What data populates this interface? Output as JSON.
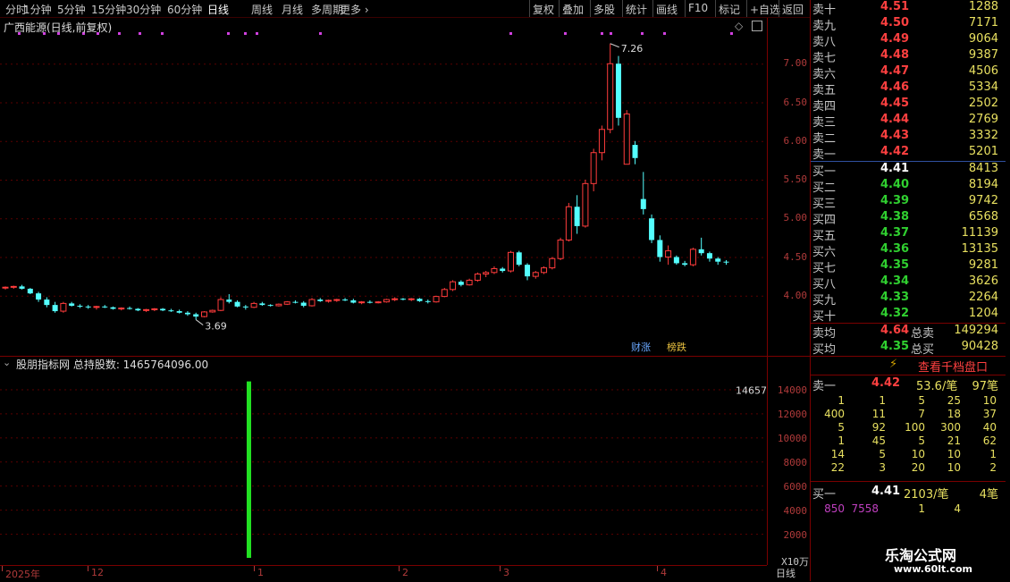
{
  "toolbar": {
    "periods": [
      "分时",
      "1分钟",
      "5分钟",
      "15分钟",
      "30分钟",
      "60分钟",
      "日线",
      "周线",
      "月线",
      "多周期",
      "更多"
    ],
    "active_period": "日线",
    "buttons": [
      "复权",
      "叠加",
      "多股",
      "统计",
      "画线",
      "F10",
      "标记",
      "+自选",
      "返回"
    ]
  },
  "stock": {
    "title": "广西能源(日线,前复权)"
  },
  "price_axis": {
    "labels": [
      "7.00",
      "6.50",
      "6.00",
      "5.50",
      "5.00",
      "4.50",
      "4.00"
    ],
    "values": [
      7.0,
      6.5,
      6.0,
      5.5,
      5.0,
      4.5,
      4.0
    ],
    "range": [
      3.5,
      7.5
    ]
  },
  "annotations": {
    "high": "7.26",
    "low": "3.69",
    "tag_caizhang": "财涨",
    "tag_bangdie": "榜跌"
  },
  "indicator": {
    "header": "股朋指标网 总持股数: 1465764096.00",
    "peak_label": "14657",
    "axis_labels": [
      "14000",
      "12000",
      "10000",
      "8000",
      "6000",
      "4000",
      "2000"
    ],
    "axis_values": [
      14000,
      12000,
      10000,
      8000,
      6000,
      4000,
      2000
    ],
    "unit": "X10万",
    "bar_value": 14657
  },
  "date_axis": {
    "labels": [
      "2025年",
      "12",
      "1",
      "2",
      "3",
      "4"
    ],
    "period_label": "日线"
  },
  "order_book": {
    "asks": [
      {
        "label": "卖十",
        "price": "4.51",
        "vol": "1288"
      },
      {
        "label": "卖九",
        "price": "4.50",
        "vol": "7171"
      },
      {
        "label": "卖八",
        "price": "4.49",
        "vol": "9064"
      },
      {
        "label": "卖七",
        "price": "4.48",
        "vol": "9387"
      },
      {
        "label": "卖六",
        "price": "4.47",
        "vol": "4506"
      },
      {
        "label": "卖五",
        "price": "4.46",
        "vol": "5334"
      },
      {
        "label": "卖四",
        "price": "4.45",
        "vol": "2502"
      },
      {
        "label": "卖三",
        "price": "4.44",
        "vol": "2769"
      },
      {
        "label": "卖二",
        "price": "4.43",
        "vol": "3332"
      },
      {
        "label": "卖一",
        "price": "4.42",
        "vol": "5201"
      }
    ],
    "bids": [
      {
        "label": "买一",
        "price": "4.41",
        "vol": "8413"
      },
      {
        "label": "买二",
        "price": "4.40",
        "vol": "8194"
      },
      {
        "label": "买三",
        "price": "4.39",
        "vol": "9742"
      },
      {
        "label": "买四",
        "price": "4.38",
        "vol": "6568"
      },
      {
        "label": "买五",
        "price": "4.37",
        "vol": "11139"
      },
      {
        "label": "买六",
        "price": "4.36",
        "vol": "13135"
      },
      {
        "label": "买七",
        "price": "4.35",
        "vol": "9281"
      },
      {
        "label": "买八",
        "price": "4.34",
        "vol": "3626"
      },
      {
        "label": "买九",
        "price": "4.33",
        "vol": "2264"
      },
      {
        "label": "买十",
        "price": "4.32",
        "vol": "1204"
      }
    ],
    "avg_sell": {
      "label": "卖均",
      "price": "4.64",
      "total_label": "总卖",
      "total": "149294"
    },
    "avg_buy": {
      "label": "买均",
      "price": "4.35",
      "total_label": "总买",
      "total": "90428"
    }
  },
  "thousand_btn": "查看千档盘口",
  "sell1_detail": {
    "label": "卖一",
    "price": "4.42",
    "per": "53.6/笔",
    "count": "97笔",
    "grid": [
      [
        "1",
        "1",
        "5",
        "25",
        "10"
      ],
      [
        "400",
        "11",
        "7",
        "18",
        "37"
      ],
      [
        "5",
        "92",
        "100",
        "300",
        "40"
      ],
      [
        "1",
        "45",
        "5",
        "21",
        "62"
      ],
      [
        "14",
        "5",
        "10",
        "10",
        "1"
      ],
      [
        "22",
        "3",
        "20",
        "10",
        "2"
      ]
    ]
  },
  "buy1_detail": {
    "label": "买一",
    "price": "4.41",
    "per": "2103/笔",
    "count": "4笔",
    "grid": [
      "850",
      "7558",
      "1",
      "4"
    ]
  },
  "watermark": {
    "line1": "乐淘公式网",
    "line2": "www.60lt.com"
  },
  "colors": {
    "up": "#ff3c3c",
    "down": "#54ffff",
    "bar": "#22e022",
    "grid": "#5a0000",
    "axis": "#b03a3a"
  },
  "chart_data": {
    "type": "candlestick",
    "candles": [
      [
        4.1,
        4.12,
        4.08,
        4.11
      ],
      [
        4.11,
        4.13,
        4.09,
        4.12
      ],
      [
        4.12,
        4.14,
        4.08,
        4.09
      ],
      [
        4.09,
        4.1,
        4.02,
        4.03
      ],
      [
        4.03,
        4.05,
        3.92,
        3.95
      ],
      [
        3.95,
        3.98,
        3.85,
        3.88
      ],
      [
        3.88,
        3.92,
        3.78,
        3.8
      ],
      [
        3.8,
        3.92,
        3.78,
        3.9
      ],
      [
        3.9,
        3.92,
        3.86,
        3.87
      ],
      [
        3.87,
        3.89,
        3.84,
        3.86
      ],
      [
        3.86,
        3.88,
        3.83,
        3.85
      ],
      [
        3.85,
        3.87,
        3.82,
        3.86
      ],
      [
        3.86,
        3.88,
        3.84,
        3.85
      ],
      [
        3.85,
        3.86,
        3.82,
        3.83
      ],
      [
        3.83,
        3.85,
        3.81,
        3.84
      ],
      [
        3.84,
        3.86,
        3.82,
        3.83
      ],
      [
        3.83,
        3.84,
        3.8,
        3.81
      ],
      [
        3.81,
        3.83,
        3.79,
        3.82
      ],
      [
        3.82,
        3.84,
        3.8,
        3.83
      ],
      [
        3.83,
        3.84,
        3.8,
        3.81
      ],
      [
        3.81,
        3.83,
        3.79,
        3.8
      ],
      [
        3.8,
        3.82,
        3.77,
        3.78
      ],
      [
        3.78,
        3.8,
        3.74,
        3.76
      ],
      [
        3.76,
        3.78,
        3.69,
        3.73
      ],
      [
        3.73,
        3.8,
        3.72,
        3.79
      ],
      [
        3.79,
        3.82,
        3.78,
        3.81
      ],
      [
        3.81,
        3.98,
        3.8,
        3.95
      ],
      [
        3.95,
        4.02,
        3.9,
        3.92
      ],
      [
        3.92,
        3.94,
        3.85,
        3.86
      ],
      [
        3.86,
        3.88,
        3.82,
        3.85
      ],
      [
        3.85,
        3.92,
        3.84,
        3.9
      ],
      [
        3.9,
        3.92,
        3.87,
        3.88
      ],
      [
        3.88,
        3.89,
        3.86,
        3.87
      ],
      [
        3.87,
        3.9,
        3.86,
        3.89
      ],
      [
        3.89,
        3.93,
        3.88,
        3.92
      ],
      [
        3.92,
        3.94,
        3.9,
        3.91
      ],
      [
        3.91,
        3.93,
        3.85,
        3.87
      ],
      [
        3.87,
        3.97,
        3.86,
        3.95
      ],
      [
        3.95,
        3.97,
        3.92,
        3.93
      ],
      [
        3.93,
        3.95,
        3.91,
        3.94
      ],
      [
        3.94,
        3.96,
        3.92,
        3.95
      ],
      [
        3.95,
        3.97,
        3.93,
        3.94
      ],
      [
        3.94,
        3.96,
        3.9,
        3.91
      ],
      [
        3.91,
        3.93,
        3.89,
        3.92
      ],
      [
        3.92,
        3.94,
        3.9,
        3.91
      ],
      [
        3.91,
        3.93,
        3.9,
        3.92
      ],
      [
        3.92,
        3.96,
        3.91,
        3.95
      ],
      [
        3.95,
        3.98,
        3.93,
        3.96
      ],
      [
        3.96,
        3.97,
        3.94,
        3.95
      ],
      [
        3.95,
        3.97,
        3.93,
        3.96
      ],
      [
        3.96,
        3.97,
        3.92,
        3.93
      ],
      [
        3.93,
        3.95,
        3.9,
        3.92
      ],
      [
        3.92,
        4.0,
        3.91,
        3.99
      ],
      [
        3.99,
        4.1,
        3.98,
        4.08
      ],
      [
        4.08,
        4.2,
        4.06,
        4.18
      ],
      [
        4.18,
        4.2,
        4.12,
        4.14
      ],
      [
        4.14,
        4.22,
        4.13,
        4.2
      ],
      [
        4.2,
        4.3,
        4.18,
        4.28
      ],
      [
        4.28,
        4.32,
        4.24,
        4.3
      ],
      [
        4.3,
        4.38,
        4.28,
        4.35
      ],
      [
        4.35,
        4.37,
        4.3,
        4.32
      ],
      [
        4.32,
        4.58,
        4.3,
        4.56
      ],
      [
        4.56,
        4.58,
        4.38,
        4.4
      ],
      [
        4.4,
        4.42,
        4.2,
        4.25
      ],
      [
        4.25,
        4.32,
        4.22,
        4.3
      ],
      [
        4.3,
        4.38,
        4.28,
        4.36
      ],
      [
        4.36,
        4.5,
        4.34,
        4.48
      ],
      [
        4.48,
        4.75,
        4.46,
        4.72
      ],
      [
        4.72,
        5.2,
        4.7,
        5.15
      ],
      [
        5.15,
        5.3,
        4.8,
        4.9
      ],
      [
        4.9,
        5.5,
        4.88,
        5.45
      ],
      [
        5.45,
        5.9,
        5.35,
        5.85
      ],
      [
        5.85,
        6.2,
        5.75,
        6.15
      ],
      [
        6.15,
        7.26,
        6.1,
        7.0
      ],
      [
        7.0,
        7.1,
        6.2,
        6.3
      ],
      [
        5.7,
        6.4,
        5.7,
        6.35
      ],
      [
        5.95,
        6.0,
        5.7,
        5.78
      ],
      [
        5.25,
        5.6,
        5.05,
        5.12
      ],
      [
        5.0,
        5.05,
        4.68,
        4.72
      ],
      [
        4.72,
        4.78,
        4.44,
        4.5
      ],
      [
        4.5,
        4.65,
        4.4,
        4.58
      ],
      [
        4.5,
        4.52,
        4.4,
        4.42
      ],
      [
        4.42,
        4.45,
        4.38,
        4.4
      ],
      [
        4.4,
        4.62,
        4.38,
        4.6
      ],
      [
        4.6,
        4.75,
        4.52,
        4.55
      ],
      [
        4.55,
        4.57,
        4.44,
        4.48
      ],
      [
        4.48,
        4.5,
        4.4,
        4.44
      ],
      [
        4.44,
        4.46,
        4.4,
        4.43
      ]
    ]
  }
}
